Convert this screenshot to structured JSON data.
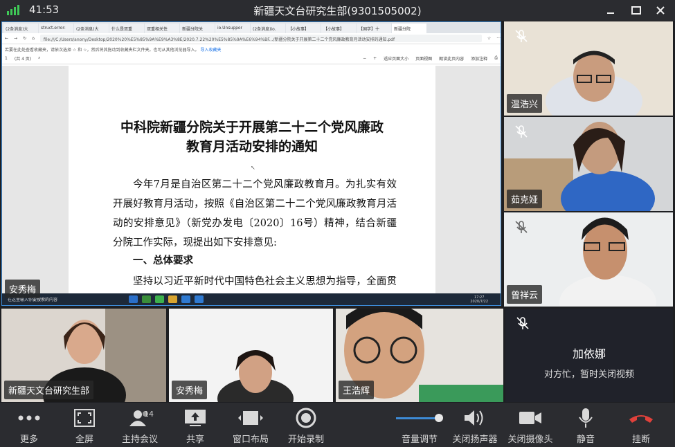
{
  "status": {
    "time": "41:53",
    "meeting_title": "新疆天文台研究生部(9301505002)"
  },
  "browser": {
    "tabs": [
      "(2条消息)大",
      "struct.error:",
      "(2条消息)大",
      "什么是双重",
      "双重相关性",
      "新疆分院关",
      "io.Unsuppor",
      "(2条消息)io.",
      "【小故事】",
      "【小故事】",
      "【国学】十",
      "新疆分院"
    ],
    "url": "file:///C:/Users/anony/Desktop/2020%20%E5%85%9A%E9%A3%8E/2020.7.22%20%E5%85%9A%E6%94%BF.../新疆分院关于开展第二十二个党风廉政教育月活动安排的通知.pdf",
    "favbar_text": "若要在此处查看收藏夹，请依次选择 ☆ 和 ☆，然后将其拖动到收藏夹栏文件夹。也可从其他浏览器导入。",
    "favbar_link": "导入收藏夹",
    "page_indicator": "1",
    "page_total": "(共 4 页)",
    "pdf_tools": [
      "适应页面大小",
      "页面视图",
      "朗读此页内容",
      "添加注释"
    ]
  },
  "document": {
    "title_line1": "中科院新疆分院关于开展第二十二个党风廉政",
    "title_line2": "教育月活动安排的通知",
    "paragraph1": "今年7月是自治区第二十二个党风廉政教育月。为扎实有效开展好教育月活动，按照《自治区第二十二个党风廉政教育月活动的安排意见》（新党办发电〔2020〕16号）精神，结合新疆分院工作实际，现提出如下安排意见:",
    "heading1": "一、总体要求",
    "paragraph2": "坚持以习近平新时代中国特色社会主义思想为指导，全面贯彻落实党的十九大精神"
  },
  "taskbar": {
    "search_placeholder": "在这里输入你要搜索的内容",
    "time": "17:27",
    "date": "2020/7/22"
  },
  "participants": {
    "share_owner": "安秀梅",
    "right": [
      "温浩兴",
      "茹克娅",
      "曾祥云"
    ],
    "bottom": [
      "新疆天文台研究生部",
      "安秀梅",
      "王浩辉"
    ],
    "camera_off": {
      "name": "加依娜",
      "message": "对方忙，暂时关闭视频"
    }
  },
  "toolbar": {
    "more": "更多",
    "fullscreen": "全屏",
    "host": "主持会议",
    "host_count": "14",
    "share": "共享",
    "layout": "窗口布局",
    "record": "开始录制",
    "volume": "音量调节",
    "speaker_off": "关闭扬声器",
    "camera_off": "关闭摄像头",
    "mute": "静音",
    "hangup": "挂断"
  },
  "colors": {
    "hangup": "#e0413b",
    "accent": "#3d8bd6",
    "signal": "#3fc957"
  }
}
